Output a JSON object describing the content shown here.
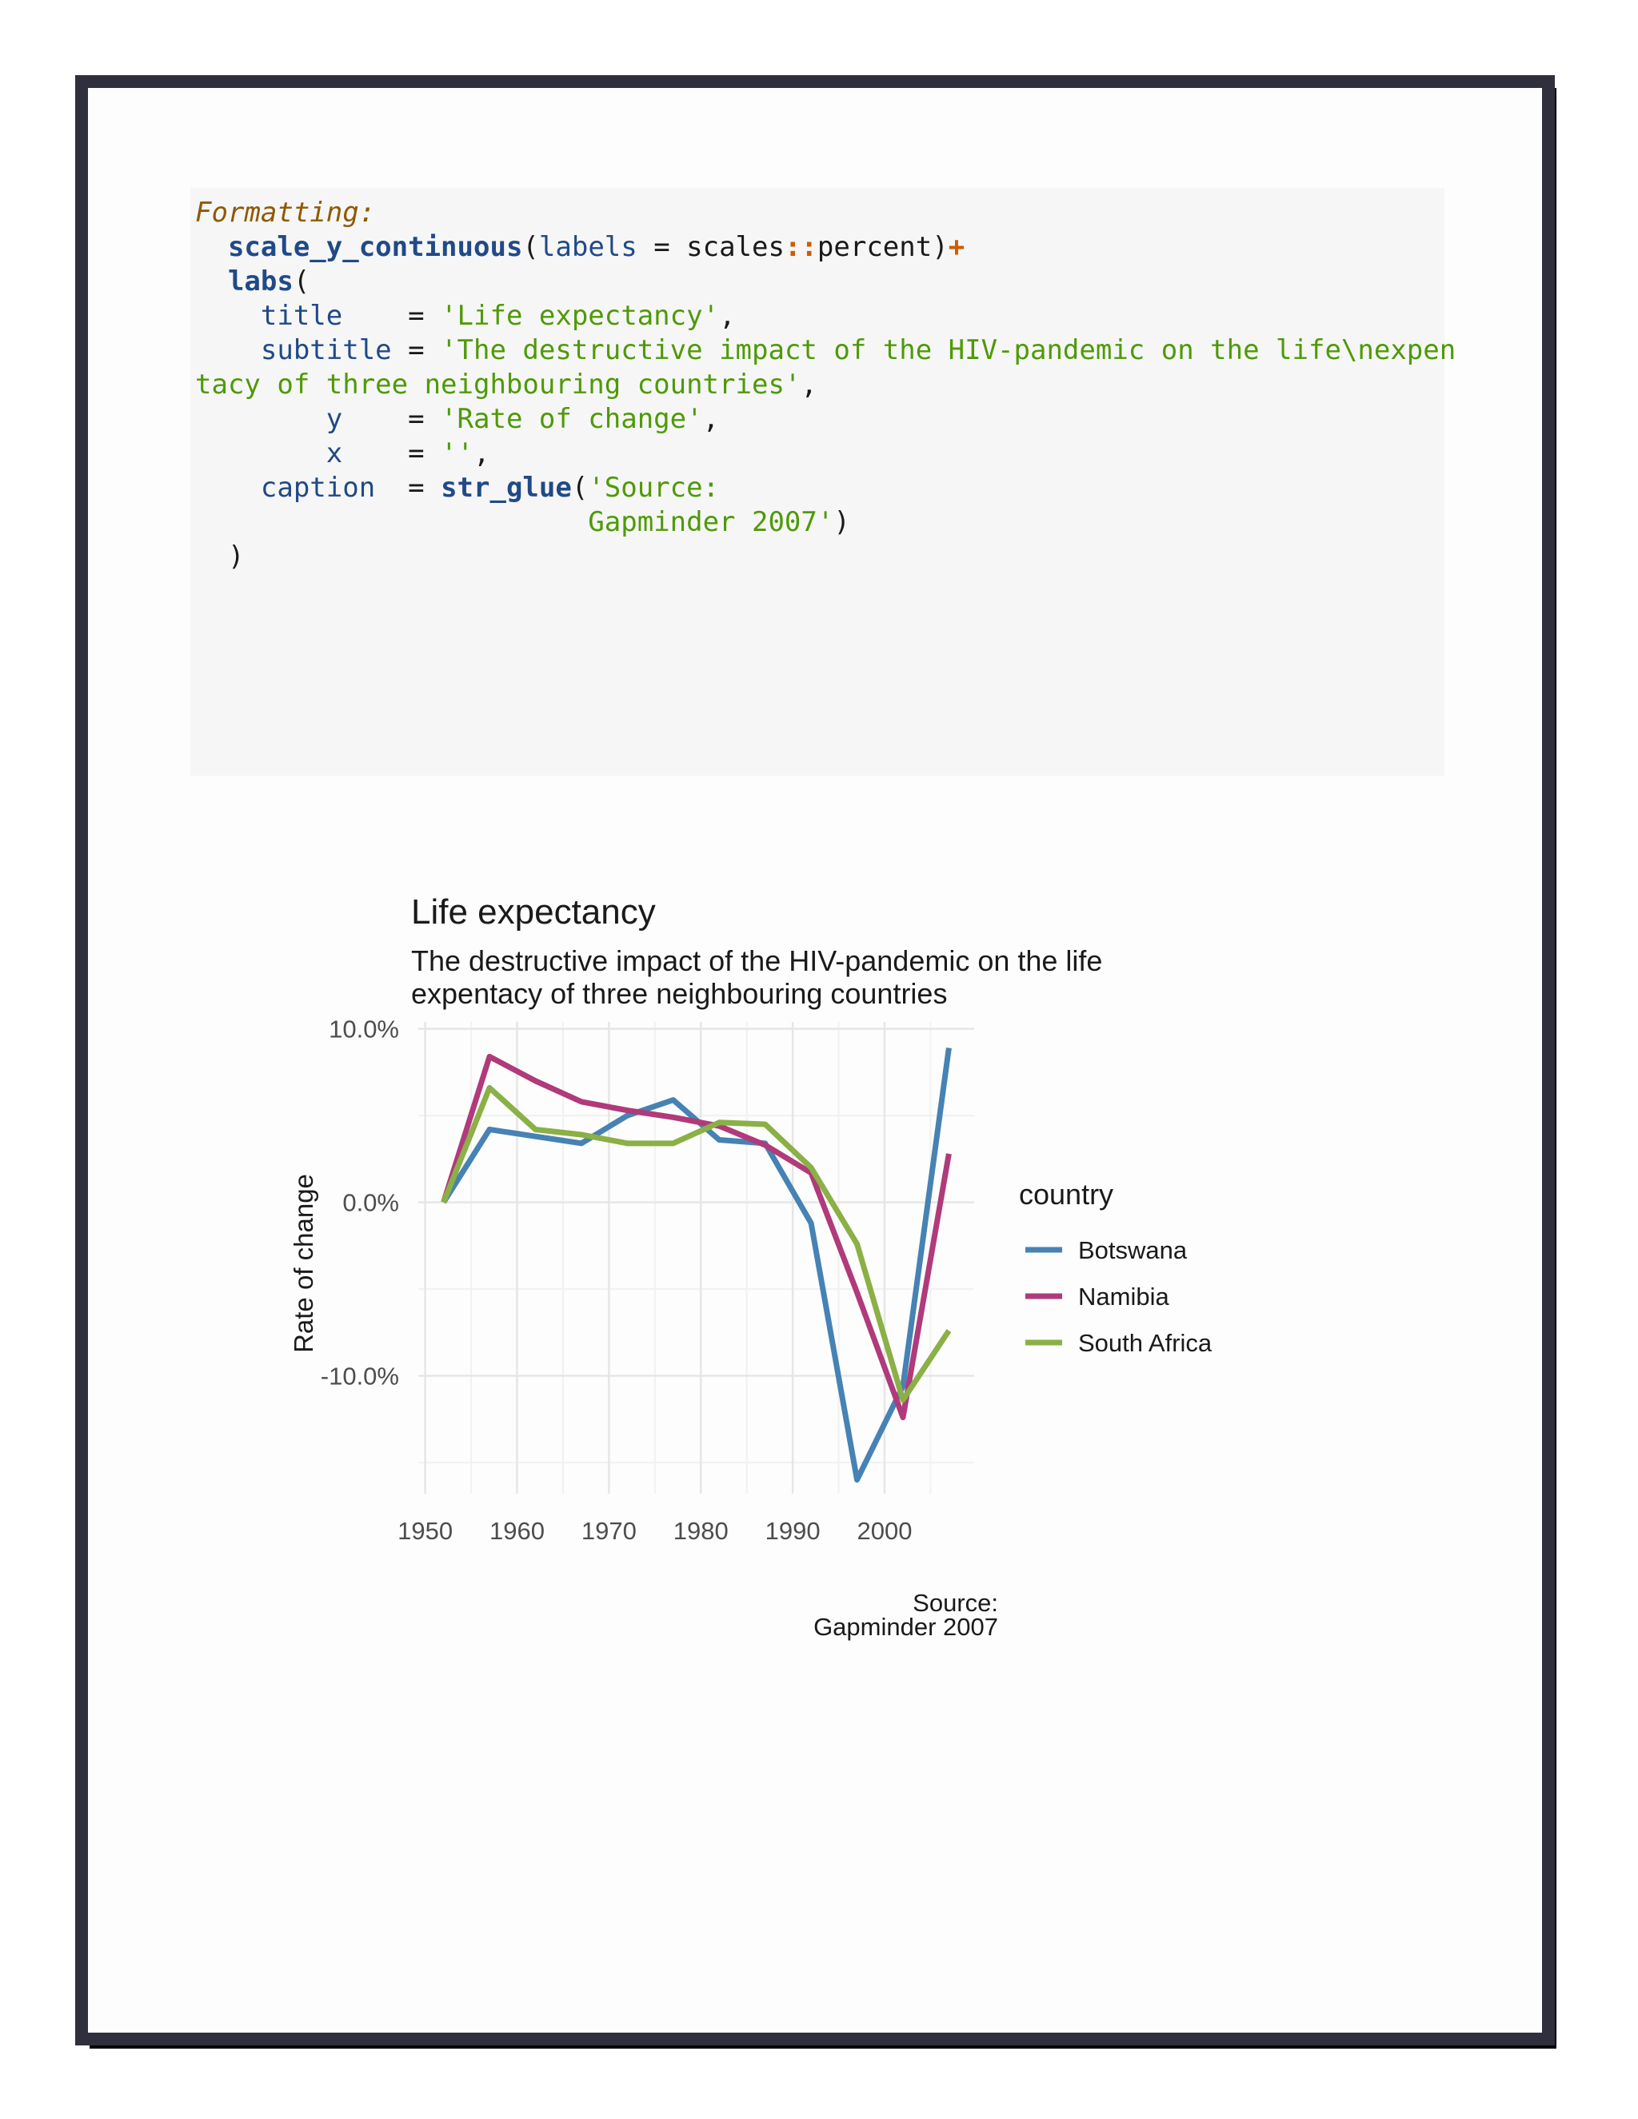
{
  "code": {
    "comment": "Formatting:",
    "l2_fn": "scale_y_continuous",
    "l2_a": "(",
    "l2_arg": "labels",
    "l2_b": " = scales",
    "l2_ns": "::",
    "l2_c": "percent)",
    "l2_plus": "+",
    "l3_fn": "labs",
    "l3_a": "(",
    "l4_arg": "title",
    "l4_eq": "    = ",
    "l4_str": "'Life expectancy'",
    "l4_end": ",",
    "l5_arg": "subtitle",
    "l5_eq": " = ",
    "l5_str": "'The destructive impact of the HIV-pandemic on the life\\nexpen",
    "l6_str": "tacy of three neighbouring countries'",
    "l6_end": ",",
    "l7_arg": "y",
    "l7_eq": "    = ",
    "l7_str": "'Rate of change'",
    "l7_end": ",",
    "l8_arg": "x",
    "l8_eq": "    = ",
    "l8_str": "''",
    "l8_end": ",",
    "l9_arg": "caption",
    "l9_eq": "  = ",
    "l9_fn": "str_glue",
    "l9_a": "(",
    "l9_str": "'Source:",
    "l10_str": "Gapminder 2007'",
    "l10_end": ")",
    "l11": ")"
  },
  "chart_data": {
    "type": "line",
    "title": "Life expectancy",
    "subtitle_lines": [
      "The destructive impact of the HIV-pandemic on the life",
      "expentacy of three neighbouring countries"
    ],
    "xlabel": "",
    "ylabel": "Rate of change",
    "caption_lines": [
      "Source:",
      "Gapminder 2007"
    ],
    "x": [
      1952,
      1957,
      1962,
      1967,
      1972,
      1977,
      1982,
      1987,
      1992,
      1997,
      2002,
      2007
    ],
    "xlim": [
      1949.25,
      2009.75
    ],
    "ylim": [
      -16.8,
      10.4
    ],
    "x_ticks": [
      1950,
      1960,
      1970,
      1980,
      1990,
      2000
    ],
    "x_tick_labels": [
      "1950",
      "1960",
      "1970",
      "1980",
      "1990",
      "2000"
    ],
    "y_ticks": [
      -10,
      0,
      10
    ],
    "y_tick_labels": [
      "-10.0%",
      "0.0%",
      "10.0%"
    ],
    "grid": true,
    "legend_title": "country",
    "legend_position": "right",
    "series": [
      {
        "name": "Botswana",
        "color": "#4682b4",
        "values": [
          0.0,
          4.2,
          3.8,
          3.4,
          5.0,
          5.9,
          3.6,
          3.4,
          -1.2,
          -16.0,
          -10.6,
          8.9
        ]
      },
      {
        "name": "Namibia",
        "color": "#b03a7a",
        "values": [
          0.0,
          8.4,
          7.0,
          5.8,
          5.3,
          4.9,
          4.4,
          3.3,
          1.7,
          -5.2,
          -12.4,
          2.8
        ]
      },
      {
        "name": "South Africa",
        "color": "#8ab046",
        "values": [
          0.0,
          6.6,
          4.2,
          3.9,
          3.4,
          3.4,
          4.6,
          4.5,
          2.0,
          -2.4,
          -11.4,
          -7.4
        ]
      }
    ]
  }
}
